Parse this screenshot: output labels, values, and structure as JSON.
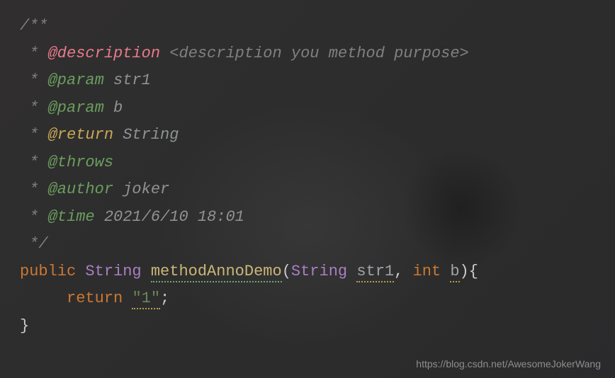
{
  "doc": {
    "open": "/**",
    "star": " * ",
    "close": " */",
    "description_tag": "@description",
    "description_text": "<description you method purpose>",
    "param_tag": "@param",
    "param1": "str1",
    "param2": "b",
    "return_tag": "@return",
    "return_type": "String",
    "throws_tag": "@throws",
    "author_tag": "@author",
    "author_val": "joker",
    "time_tag": "@time",
    "time_val": "2021/6/10 18:01"
  },
  "code": {
    "kw_public": "public",
    "type_string": "String",
    "method_name": "methodAnnoDemo",
    "param1_type": "String",
    "param1_name": "str1",
    "param2_type": "int",
    "param2_name": "b",
    "kw_return": "return",
    "string_val": "\"1\"",
    "brace_open": "{",
    "brace_close": "}",
    "paren_open": "(",
    "paren_close": ")",
    "comma": ",",
    "semicolon": ";"
  },
  "watermark": "https://blog.csdn.net/AwesomeJokerWang"
}
